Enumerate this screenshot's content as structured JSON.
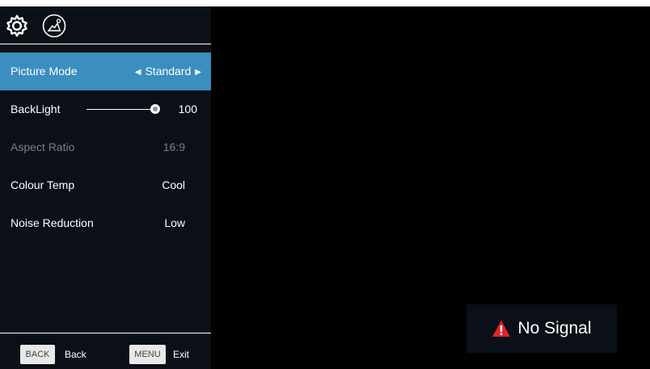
{
  "header": {
    "icons": [
      "gear-icon",
      "picture-icon"
    ]
  },
  "menu": {
    "items": [
      {
        "label": "Picture Mode",
        "value": "Standard",
        "state": "selected"
      },
      {
        "label": "BackLight",
        "value": "100",
        "control": "slider",
        "level": 1.0
      },
      {
        "label": "Aspect Ratio",
        "value": "16:9",
        "state": "disabled"
      },
      {
        "label": "Colour Temp",
        "value": "Cool"
      },
      {
        "label": "Noise Reduction",
        "value": "Low"
      }
    ]
  },
  "footer": {
    "back_key": "BACK",
    "back_label": "Back",
    "menu_key": "MENU",
    "exit_label": "Exit"
  },
  "status": {
    "message": "No Signal",
    "icon": "warning-icon"
  },
  "colors": {
    "selected_row": "#3a8ec0",
    "panel_background": "#0b0f17",
    "warning": "#e0242b"
  }
}
